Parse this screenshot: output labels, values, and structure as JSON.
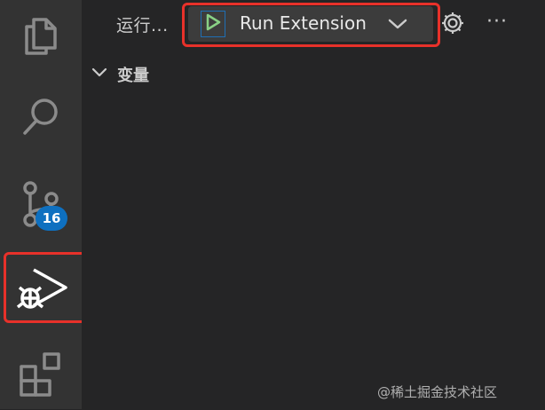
{
  "header": {
    "run_label": "运行...",
    "launch_config": "Run Extension",
    "more_label": "···"
  },
  "sections": {
    "variables_label": "变量"
  },
  "activity_bar": {
    "items": [
      "explorer",
      "search",
      "source-control",
      "run-and-debug",
      "extensions"
    ],
    "scm_badge": "16"
  },
  "watermark": "@稀土掘金技术社区",
  "colors": {
    "highlight": "#e8312a",
    "badge": "#0e70c0",
    "play_icon": "#89d185"
  }
}
